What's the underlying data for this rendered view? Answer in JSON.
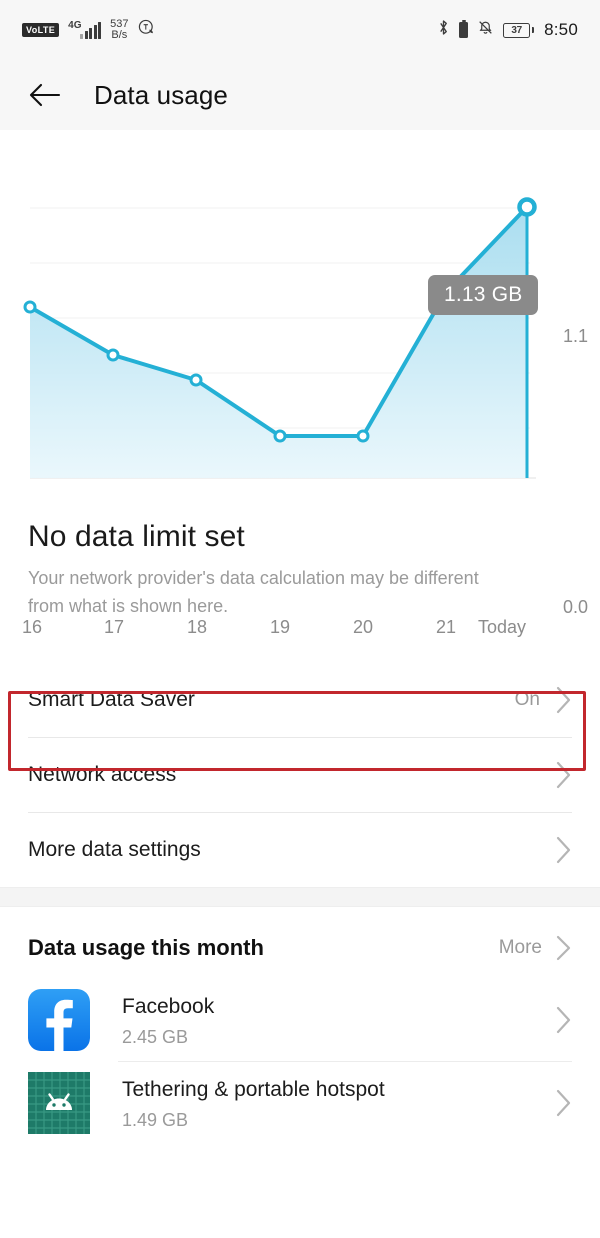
{
  "statusbar": {
    "volte": "VoLTE",
    "network_gen": "4G",
    "data_rate_value": "537",
    "data_rate_unit": "B/s",
    "battery_percent": "37",
    "clock": "8:50",
    "icons": [
      "volte-badge",
      "signal-bars-icon",
      "data-rate-indicator",
      "eye-comfort-icon",
      "bluetooth-icon",
      "vibrate-icon",
      "mute-icon",
      "battery-icon"
    ]
  },
  "appbar": {
    "back_icon": "back-arrow-icon",
    "title": "Data usage"
  },
  "chart_data": {
    "type": "area",
    "title": "Data usage",
    "tooltip": "1.13 GB",
    "categories": [
      "16",
      "17",
      "18",
      "19",
      "20",
      "21",
      "Today"
    ],
    "values": [
      0.62,
      0.5,
      0.43,
      0.17,
      0.17,
      0.75,
      1.13
    ],
    "ylim": [
      0.0,
      1.1
    ],
    "ytick_labels": [
      "0.0",
      "1.1"
    ],
    "xlabel": "",
    "ylabel": "",
    "grid": true,
    "line_color": "#24b0d5",
    "fill_top_color": "#aadff0",
    "fill_bottom_color": "#e8f6fc",
    "unit": "GB"
  },
  "headline": {
    "title": "No data limit set",
    "subtitle": "Your network provider's data calculation may be different from what is shown here."
  },
  "settings_rows": [
    {
      "label": "Smart Data Saver",
      "value": "On",
      "highlighted": true
    },
    {
      "label": "Network access",
      "value": "",
      "highlighted": false
    },
    {
      "label": "More data settings",
      "value": "",
      "highlighted": false
    }
  ],
  "highlight_color": "#c2272d",
  "usage_section": {
    "title": "Data usage this month",
    "more_label": "More",
    "apps": [
      {
        "name": "Facebook",
        "size": "2.45 GB",
        "icon": "facebook-icon",
        "icon_color": "#1f8ff0"
      },
      {
        "name": "Tethering & portable hotspot",
        "size": "1.49 GB",
        "icon": "android-hotspot-icon",
        "icon_color": "#1e7a68"
      }
    ]
  }
}
